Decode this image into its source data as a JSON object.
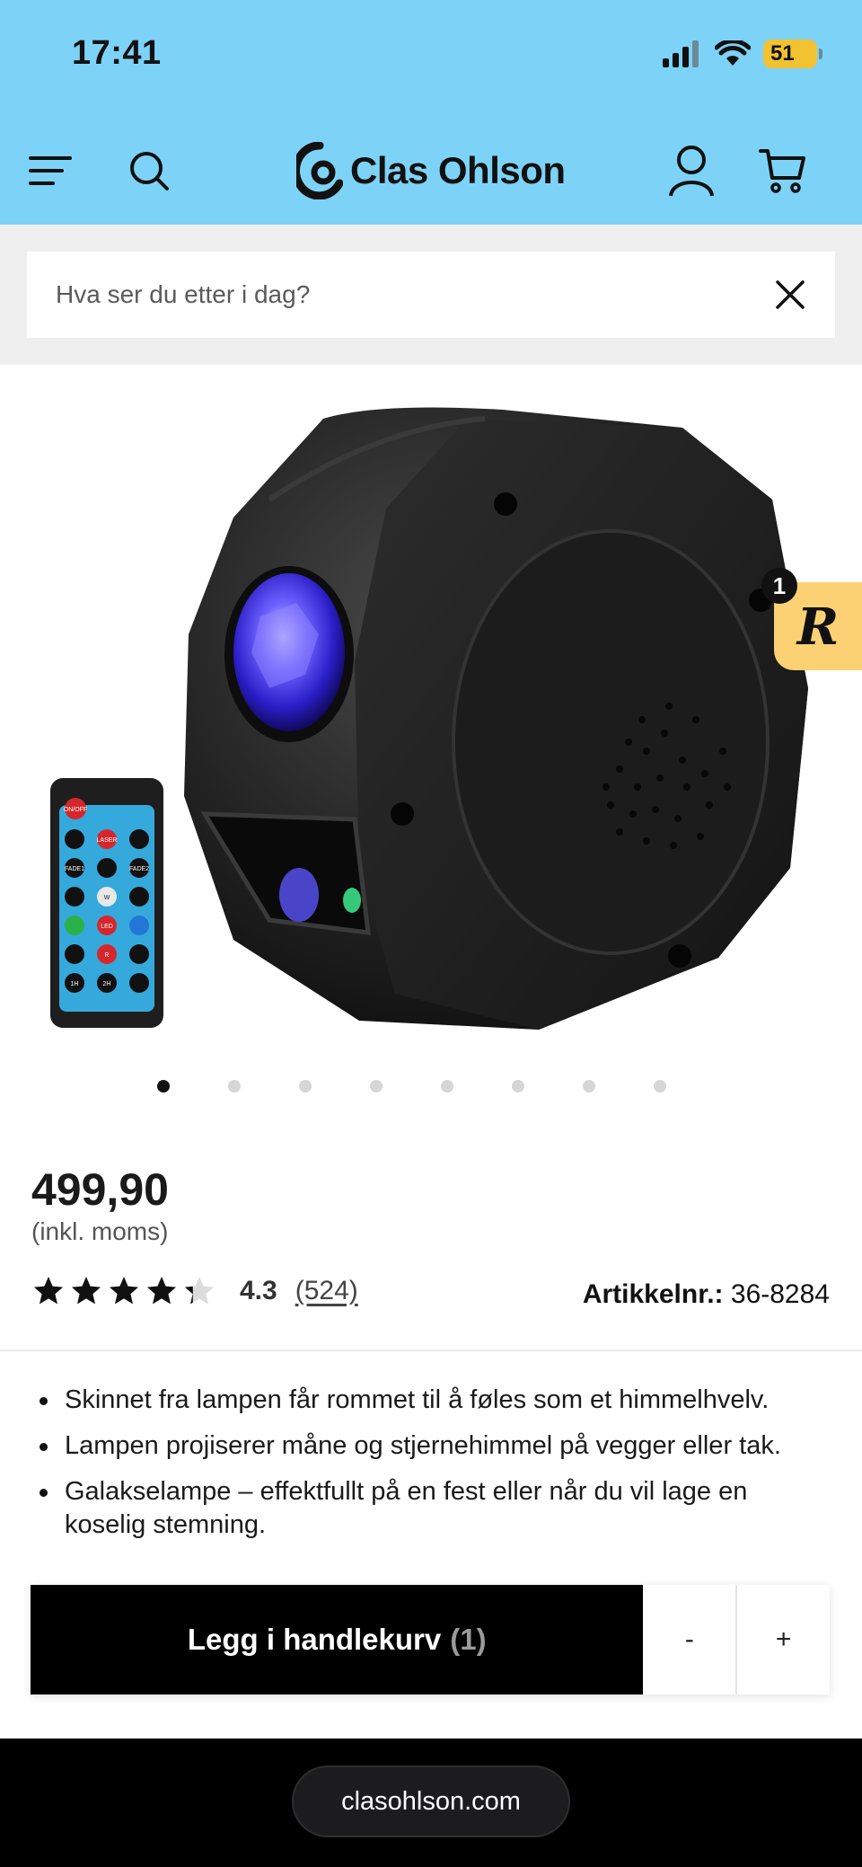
{
  "status_bar": {
    "time": "17:41",
    "battery": "51"
  },
  "header": {
    "brand": "Clas Ohlson"
  },
  "search": {
    "placeholder": "Hva ser du etter i dag?"
  },
  "gallery": {
    "slide_count": 8,
    "active_index": 0,
    "badge_count": "1",
    "remote_labels": [
      "ON/OFF",
      "LASER",
      "FADE1",
      "FADE2",
      "W",
      "LED",
      "R",
      "1H",
      "2H"
    ]
  },
  "product": {
    "price": "499,90",
    "vat_note": "(inkl. moms)",
    "rating": {
      "value": "4.3",
      "stars": 4.3,
      "count_label": "(524)"
    },
    "article_label": "Artikkelnr.:",
    "article_number": "36-8284",
    "features": [
      "Skinnet fra lampen får rommet til å føles som et himmelhvelv.",
      "Lampen projiserer måne og stjernehimmel på vegger eller tak.",
      "Galakselampe – effektfullt på en fest eller når du vil lage en koselig stemning."
    ]
  },
  "cart": {
    "button_label": "Legg i handlekurv",
    "quantity": "(1)",
    "decrease_label": "-",
    "increase_label": "+"
  },
  "browser": {
    "url": "clasohlson.com"
  },
  "colors": {
    "header_bg": "#7dd3f7",
    "battery": "#f2c230",
    "badge": "#fcd173",
    "cart_button": "#000000"
  }
}
